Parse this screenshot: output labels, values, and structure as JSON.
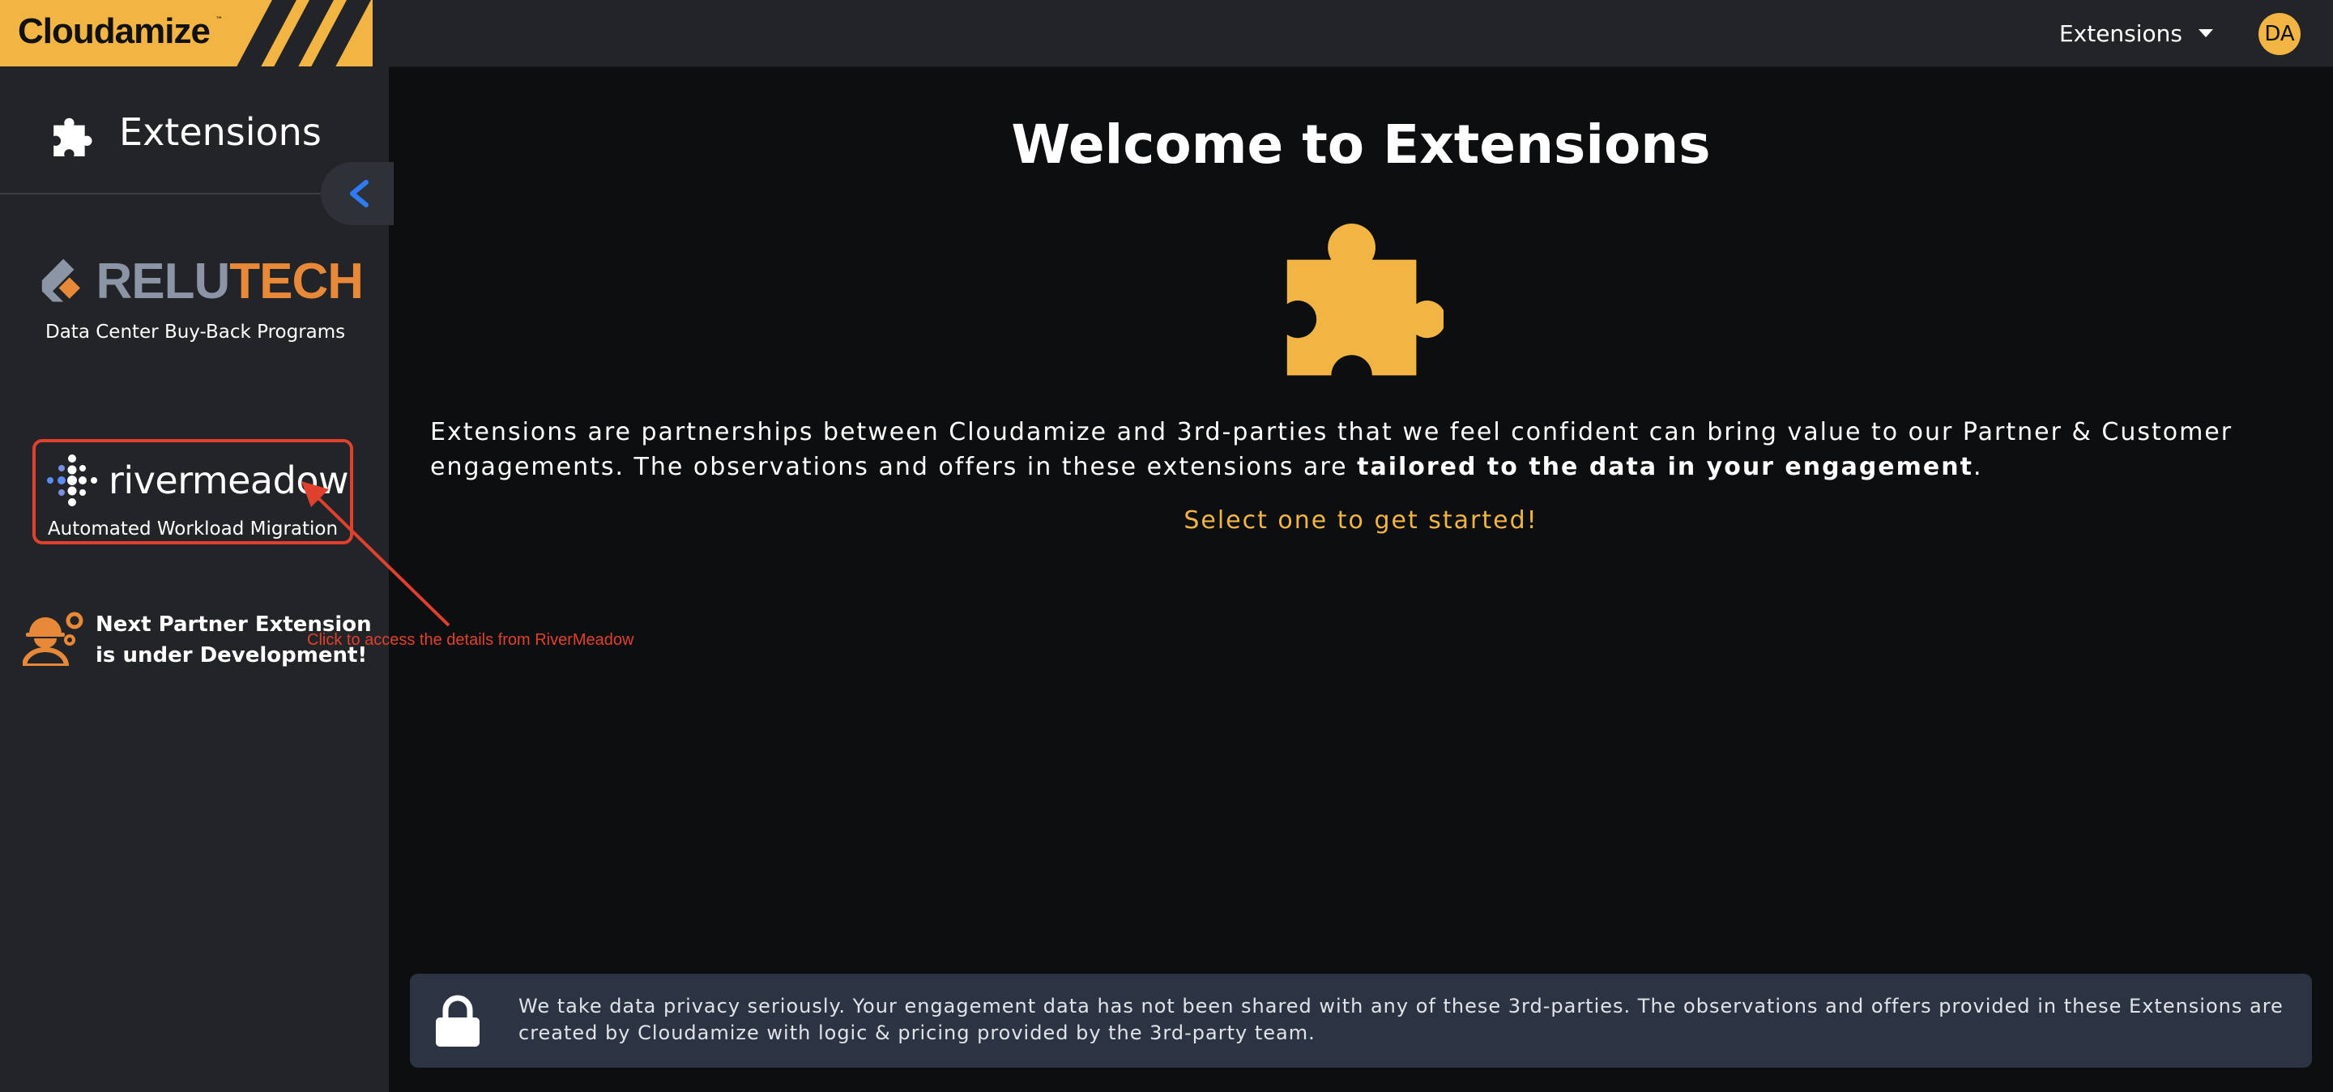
{
  "topbar": {
    "brand": "Cloudamize",
    "brand_tm": "™",
    "menu_label": "Extensions",
    "avatar_initials": "DA"
  },
  "sidebar": {
    "title": "Extensions",
    "partners": [
      {
        "name_part1": "RELU",
        "name_part2": "TECH",
        "subtitle": "Data Center Buy-Back Programs"
      },
      {
        "name": "rivermeadow",
        "subtitle": "Automated Workload Migration"
      }
    ],
    "next_partner_text": "Next Partner Extension is under Development!"
  },
  "annotation": {
    "text": "Click to access the details from RiverMeadow"
  },
  "main": {
    "title": "Welcome to Extensions",
    "description_plain": "Extensions are partnerships between Cloudamize and 3rd-parties that we feel confident can bring value to our Partner & Customer engagements. The observations and offers in these extensions are ",
    "description_bold": "tailored to the data in your engagement",
    "description_end": ".",
    "cta": "Select one to get started!"
  },
  "privacy": {
    "text": "We take data privacy seriously. Your engagement data has not been shared with any of these 3rd-parties. The observations and offers provided in these Extensions are created by Cloudamize with logic & pricing provided by the 3rd-party team."
  },
  "colors": {
    "accent": "#f2b544",
    "relutech_gray": "#8b95a5",
    "relutech_orange": "#e8893a",
    "annotation_red": "#e0412e",
    "collapse_blue": "#2f7bf5"
  }
}
